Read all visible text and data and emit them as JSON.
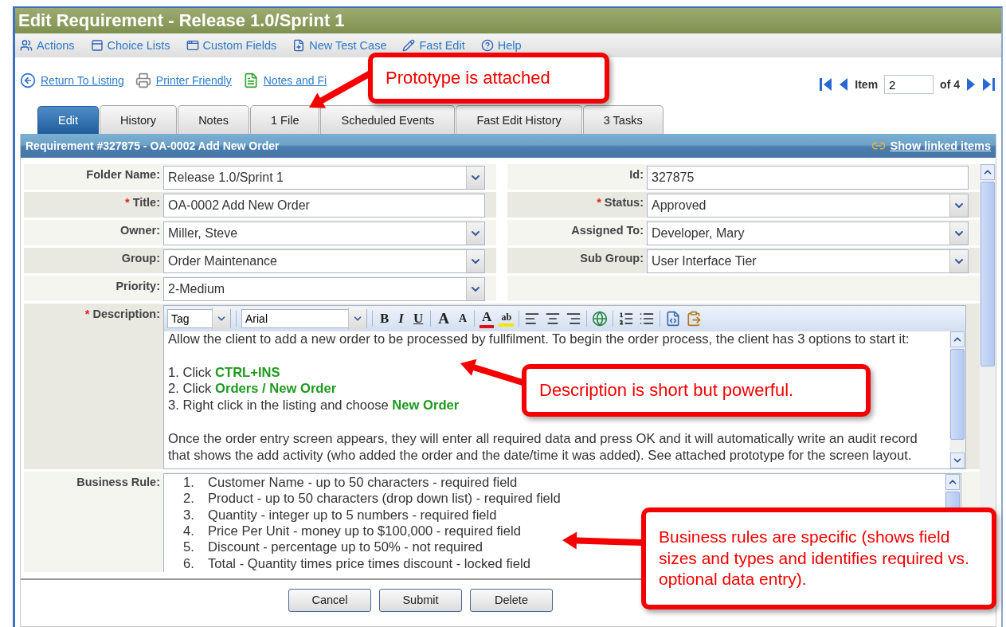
{
  "window": {
    "title": "Edit Requirement - Release 1.0/Sprint 1"
  },
  "toolbar": [
    {
      "label": "Actions"
    },
    {
      "label": "Choice Lists"
    },
    {
      "label": "Custom Fields"
    },
    {
      "label": "New Test Case"
    },
    {
      "label": "Fast Edit"
    },
    {
      "label": "Help"
    }
  ],
  "links": [
    {
      "label": "Return To Listing"
    },
    {
      "label": "Printer Friendly"
    },
    {
      "label": "Notes and Fi"
    }
  ],
  "pager": {
    "label": "Item",
    "value": "2",
    "total": "of 4"
  },
  "tabs": [
    {
      "label": "Edit",
      "selected": true
    },
    {
      "label": "History",
      "selected": false
    },
    {
      "label": "Notes",
      "selected": false
    },
    {
      "label": "1 File",
      "selected": false
    },
    {
      "label": "Scheduled Events",
      "selected": false
    },
    {
      "label": "Fast Edit History",
      "selected": false
    },
    {
      "label": "3 Tasks",
      "selected": false
    }
  ],
  "header": {
    "title": "Requirement #327875 - OA-0002 Add New Order",
    "link": "Show linked items"
  },
  "rows": [
    {
      "left": {
        "label": "Folder Name:",
        "kind": "select",
        "value": "Release 1.0/Sprint 1"
      },
      "right": {
        "label": "Id:",
        "kind": "text",
        "value": "327875"
      }
    },
    {
      "left": {
        "required_mark": "*",
        "label": "Title:",
        "kind": "text",
        "value": "OA-0002 Add New Order"
      },
      "right": {
        "required_mark": "*",
        "label": "Status:",
        "kind": "select",
        "value": "Approved"
      }
    },
    {
      "left": {
        "label": "Owner:",
        "kind": "select",
        "value": "Miller, Steve"
      },
      "right": {
        "label": "Assigned To:",
        "kind": "select",
        "value": "Developer, Mary"
      }
    },
    {
      "left": {
        "label": "Group:",
        "kind": "select",
        "value": "Order Maintenance"
      },
      "right": {
        "label": "Sub Group:",
        "kind": "select",
        "value": "User Interface Tier"
      }
    },
    {
      "left": {
        "label": "Priority:",
        "kind": "select",
        "value": "2-Medium"
      },
      "right": null
    }
  ],
  "description": {
    "required_mark": "*",
    "label": "Description:",
    "tag": "Tag",
    "font": "Arial",
    "format_buttons": [
      {
        "label": "B",
        "kind": "bold"
      },
      {
        "label": "I",
        "kind": "italic"
      },
      {
        "label": "U",
        "kind": "underline"
      },
      {
        "label": "A",
        "kind": "grow"
      },
      {
        "label": "A",
        "kind": "shrink"
      },
      {
        "label": "A",
        "kind": "color"
      },
      {
        "label": "ab",
        "kind": "highlight"
      }
    ],
    "paragraphs": [
      [
        "Allow the client to add a new order to be processed by fullfilment.  To begin the order process, the client has 3 options to start it:"
      ],
      [
        "1. Click **CTRL+INS**",
        "2. Click **Orders / New Order**",
        "3. Right click in the listing and choose **New Order**"
      ],
      [
        "Once the order entry screen appears, they will enter all required data and press OK and it will automatically write an audit record",
        "that shows the add activity (who added the order and the date/time it was added).  See attached prototype for the screen layout."
      ]
    ]
  },
  "business_rule": {
    "label": "Business Rule:",
    "items": [
      {
        "number": "1.",
        "text": "Customer Name - up to 50 characters - required field"
      },
      {
        "number": "2.",
        "text": "Product - up to 50 characters (drop down list) - required field"
      },
      {
        "number": "3.",
        "text": "Quantity - integer up to 5 numbers - required field"
      },
      {
        "number": "4.",
        "text": "Price Per Unit - money up to $100,000 - required field"
      },
      {
        "number": "5.",
        "text": "Discount - percentage up to 50% - not required"
      },
      {
        "number": "6.",
        "text": "Total - Quantity times price times discount - locked field"
      }
    ]
  },
  "buttons": [
    "Cancel",
    "Submit",
    "Delete"
  ],
  "callouts": [
    {
      "text": "Prototype is attached"
    },
    {
      "text": "Description is short but powerful."
    },
    {
      "text": "Business rules are specific (shows field sizes and types and identifies required vs. optional data entry)."
    }
  ]
}
